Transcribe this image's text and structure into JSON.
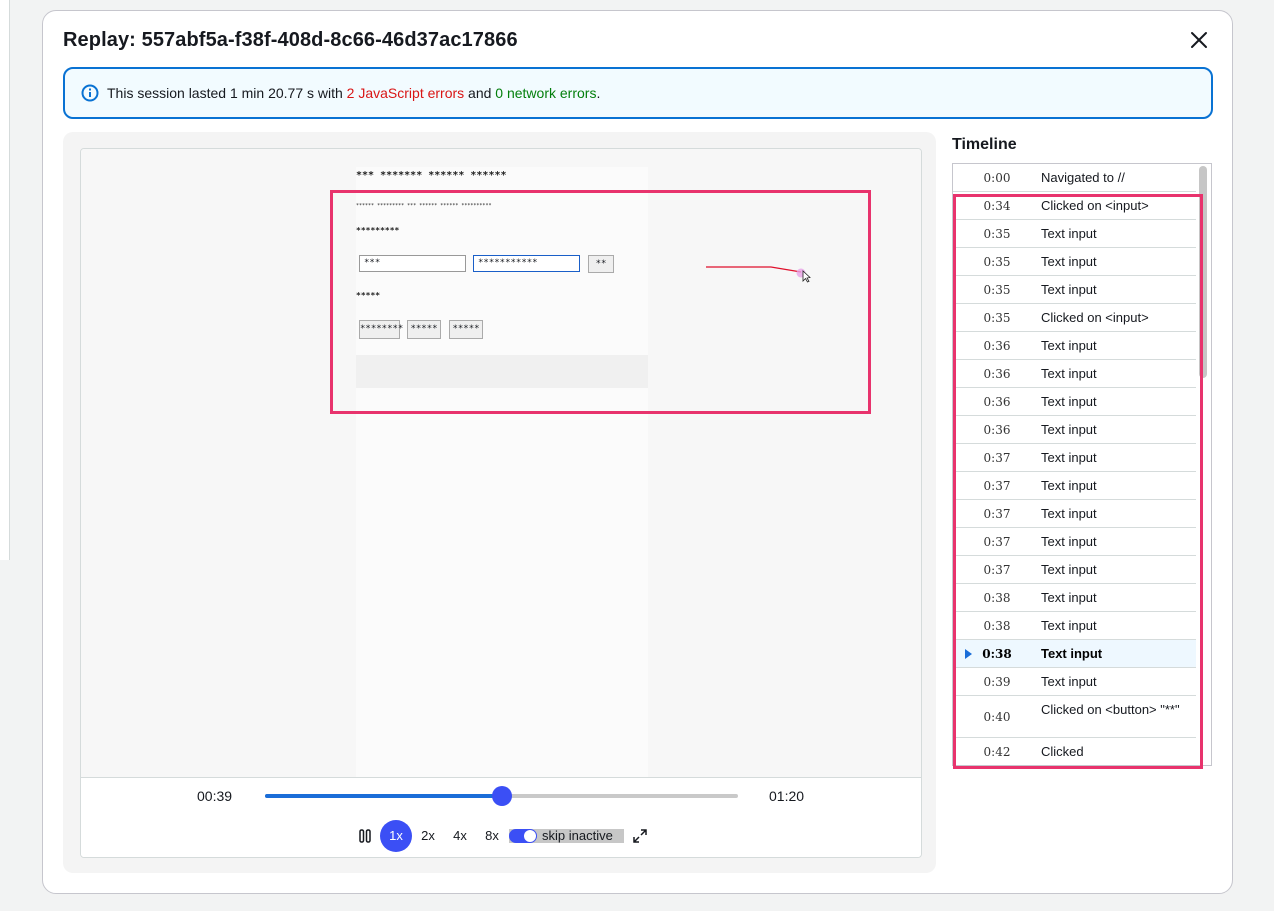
{
  "modal": {
    "title": "Replay: 557abf5a-f38f-408d-8c66-46d37ac17866"
  },
  "alert": {
    "prefix": "This session lasted 1 min 20.77 s with ",
    "js_errors": "2 JavaScript errors",
    "middle": " and ",
    "network_errors": "0 network errors",
    "suffix": "."
  },
  "replay_page": {
    "heading": "*** ******* ****** ******",
    "subtext": "****** ********* *** ****** ****** **********",
    "label1": "*********",
    "input1_value": "***",
    "input2_value": "***********",
    "small_button": "**",
    "label2": "*****",
    "buttons": [
      "********",
      "*****",
      "*****"
    ]
  },
  "player": {
    "current_time": "00:39",
    "total_time": "01:20",
    "progress": 0.5,
    "speeds": [
      "1x",
      "2x",
      "4x",
      "8x"
    ],
    "active_speed": "1x",
    "skip_inactive_label": "skip inactive",
    "skip_inactive_on": true
  },
  "timeline": {
    "title": "Timeline",
    "events": [
      {
        "time": "0:00",
        "label": "Navigated to //"
      },
      {
        "time": "0:34",
        "label": "Clicked on <input>"
      },
      {
        "time": "0:35",
        "label": "Text input"
      },
      {
        "time": "0:35",
        "label": "Text input"
      },
      {
        "time": "0:35",
        "label": "Text input"
      },
      {
        "time": "0:35",
        "label": "Clicked on <input>"
      },
      {
        "time": "0:36",
        "label": "Text input"
      },
      {
        "time": "0:36",
        "label": "Text input"
      },
      {
        "time": "0:36",
        "label": "Text input"
      },
      {
        "time": "0:36",
        "label": "Text input"
      },
      {
        "time": "0:37",
        "label": "Text input"
      },
      {
        "time": "0:37",
        "label": "Text input"
      },
      {
        "time": "0:37",
        "label": "Text input"
      },
      {
        "time": "0:37",
        "label": "Text input"
      },
      {
        "time": "0:37",
        "label": "Text input"
      },
      {
        "time": "0:38",
        "label": "Text input"
      },
      {
        "time": "0:38",
        "label": "Text input"
      },
      {
        "time": "0:38",
        "label": "Text input",
        "active": true
      },
      {
        "time": "0:39",
        "label": "Text input"
      },
      {
        "time": "0:40",
        "label": "Clicked on <button> \"**\""
      },
      {
        "time": "0:42",
        "label": "Clicked"
      }
    ]
  },
  "colors": {
    "accent": "#3b4ff5",
    "info_blue": "#0972d3",
    "error_red": "#d91515",
    "success_green": "#037f0c",
    "highlight_pink": "#e8336d"
  },
  "icons": {
    "close": "close-icon",
    "info": "info-icon",
    "pause": "pause-icon",
    "fullscreen": "fullscreen-icon",
    "play_marker": "play-marker-icon"
  }
}
